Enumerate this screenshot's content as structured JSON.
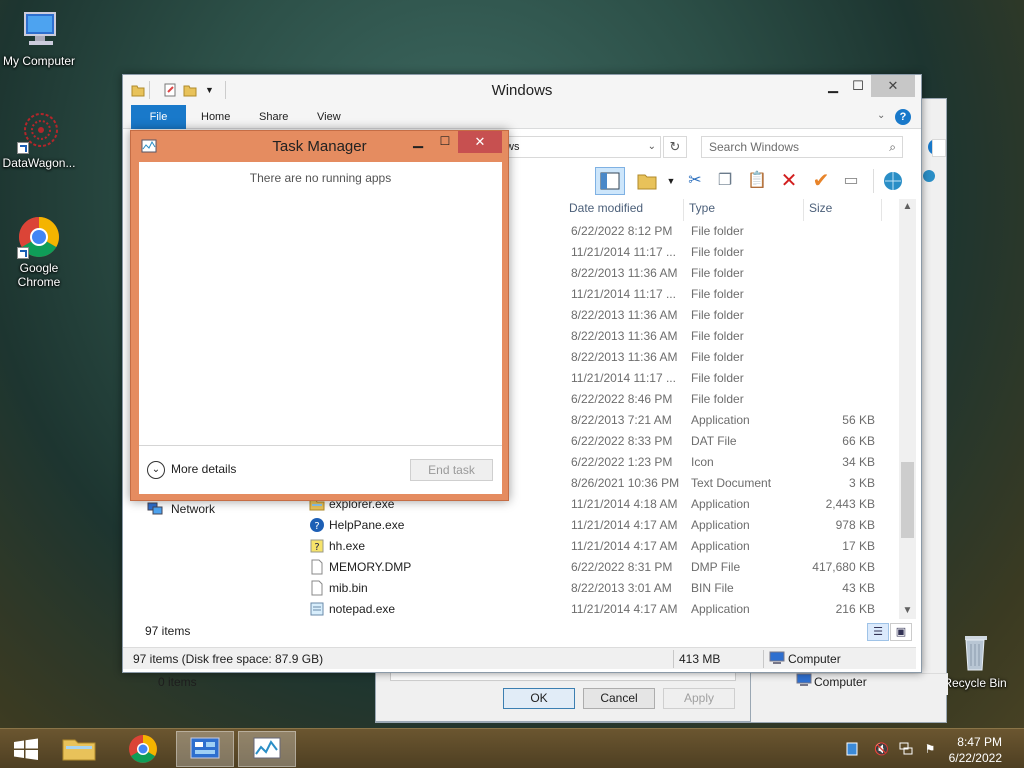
{
  "desktop": {
    "icons": [
      {
        "label": "My Computer"
      },
      {
        "label": "DataWagon..."
      },
      {
        "label": "Google Chrome"
      },
      {
        "label": "Recycle Bin"
      }
    ]
  },
  "explorer": {
    "title": "Windows",
    "tabs": {
      "file": "File",
      "home": "Home",
      "share": "Share",
      "view": "View"
    },
    "address_fragment": "ws",
    "search_placeholder": "Search Windows",
    "columns": {
      "date": "Date modified",
      "type": "Type",
      "size": "Size"
    },
    "rows": [
      {
        "name": "",
        "date": "6/22/2022 8:12 PM",
        "type": "File folder",
        "size": "",
        "icon": "folder-icon"
      },
      {
        "name": "",
        "date": "11/21/2014 11:17 ...",
        "type": "File folder",
        "size": "",
        "icon": "folder-icon"
      },
      {
        "name": "",
        "date": "8/22/2013 11:36 AM",
        "type": "File folder",
        "size": "",
        "icon": "folder-icon"
      },
      {
        "name": "",
        "date": "11/21/2014 11:17 ...",
        "type": "File folder",
        "size": "",
        "icon": "folder-icon"
      },
      {
        "name": "",
        "date": "8/22/2013 11:36 AM",
        "type": "File folder",
        "size": "",
        "icon": "folder-icon"
      },
      {
        "name": "",
        "date": "8/22/2013 11:36 AM",
        "type": "File folder",
        "size": "",
        "icon": "folder-icon"
      },
      {
        "name": "",
        "date": "8/22/2013 11:36 AM",
        "type": "File folder",
        "size": "",
        "icon": "folder-icon"
      },
      {
        "name": "",
        "date": "11/21/2014 11:17 ...",
        "type": "File folder",
        "size": "",
        "icon": "folder-icon"
      },
      {
        "name": "",
        "date": "6/22/2022 8:46 PM",
        "type": "File folder",
        "size": "",
        "icon": "folder-icon"
      },
      {
        "name": "",
        "date": "8/22/2013 7:21 AM",
        "type": "Application",
        "size": "56 KB",
        "icon": "app-icon"
      },
      {
        "name": "",
        "date": "6/22/2022 8:33 PM",
        "type": "DAT File",
        "size": "66 KB",
        "icon": "file-icon"
      },
      {
        "name": "",
        "date": "6/22/2022 1:23 PM",
        "type": "Icon",
        "size": "34 KB",
        "icon": "file-icon"
      },
      {
        "name": "",
        "date": "8/26/2021 10:36 PM",
        "type": "Text Document",
        "size": "3 KB",
        "icon": "file-icon"
      },
      {
        "name": "explorer.exe",
        "date": "11/21/2014 4:18 AM",
        "type": "Application",
        "size": "2,443 KB",
        "icon": "explorer-icon"
      },
      {
        "name": "HelpPane.exe",
        "date": "11/21/2014 4:17 AM",
        "type": "Application",
        "size": "978 KB",
        "icon": "help-icon"
      },
      {
        "name": "hh.exe",
        "date": "11/21/2014 4:17 AM",
        "type": "Application",
        "size": "17 KB",
        "icon": "hh-icon"
      },
      {
        "name": "MEMORY.DMP",
        "date": "6/22/2022 8:31 PM",
        "type": "DMP File",
        "size": "417,680 KB",
        "icon": "file-icon"
      },
      {
        "name": "mib.bin",
        "date": "8/22/2013 3:01 AM",
        "type": "BIN File",
        "size": "43 KB",
        "icon": "file-icon"
      },
      {
        "name": "notepad.exe",
        "date": "11/21/2014 4:17 AM",
        "type": "Application",
        "size": "216 KB",
        "icon": "notepad-icon"
      }
    ],
    "nav_network": "Network",
    "item_count": "97 items",
    "status_left": "97 items (Disk free space: 87.9 GB)",
    "status_size": "413 MB",
    "status_location": "Computer"
  },
  "back_window": {
    "item_count": "0 items",
    "location": "Computer",
    "ok": "OK",
    "cancel": "Cancel",
    "apply": "Apply"
  },
  "task_manager": {
    "title": "Task Manager",
    "empty_message": "There are no running apps",
    "more_details": "More details",
    "end_task": "End task"
  },
  "taskbar": {
    "time": "8:47 PM",
    "date": "6/22/2022"
  },
  "colors": {
    "accent": "#1979ca",
    "taskmgr_frame": "#e58c60",
    "close_red": "#c75050"
  }
}
